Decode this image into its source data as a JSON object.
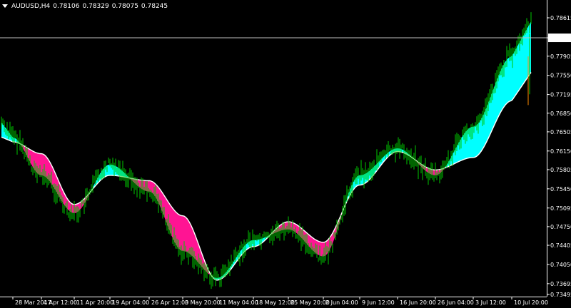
{
  "header": {
    "symbol": "AUDUSD,H4",
    "open": "0.78106",
    "high": "0.78329",
    "low": "0.78075",
    "close": "0.78245"
  },
  "colors": {
    "background": "#000000",
    "candles": "#00c800",
    "band_up": "#00ffff",
    "band_down": "#ff1493",
    "ma_line": "#ffffff",
    "price_line": "#c0c0c0"
  },
  "chart_data": {
    "type": "line",
    "ylim": [
      0.73495,
      0.78615
    ],
    "current_price": "0.78245",
    "price_ticks": [
      "0.78615",
      "0.78245",
      "0.77905",
      "0.77550",
      "0.77195",
      "0.76850",
      "0.76505",
      "0.76150",
      "0.75805",
      "0.75450",
      "0.75095",
      "0.74750",
      "0.74405",
      "0.74050",
      "0.73695",
      "0.73495"
    ],
    "time_ticks": [
      "28 Mar 2017",
      "4 Apr 12:00",
      "11 Apr 20:00",
      "19 Apr 04:00",
      "26 Apr 12:00",
      "3 May 20:00",
      "11 May 04:00",
      "18 May 12:00",
      "25 May 20:00",
      "2 Jun 04:00",
      "9 Jun 12:00",
      "16 Jun 20:00",
      "26 Jun 04:00",
      "3 Jul 12:00",
      "10 Jul 20:00"
    ],
    "series": [
      {
        "x": [
          "28 Mar 2017",
          "4 Apr 12:00",
          "11 Apr 20:00",
          "19 Apr 04:00",
          "26 Apr 12:00",
          "3 May 20:00",
          "11 May 04:00",
          "18 May 12:00",
          "25 May 20:00",
          "2 Jun 04:00",
          "9 Jun 12:00",
          "16 Jun 20:00",
          "26 Jun 04:00",
          "3 Jul 12:00",
          "10 Jul 20:00"
        ],
        "values": [
          0.7632,
          0.761,
          0.7516,
          0.757,
          0.756,
          0.7495,
          0.7376,
          0.7438,
          0.7484,
          0.7446,
          0.7552,
          0.7614,
          0.758,
          0.7603,
          0.7708
        ]
      },
      {
        "x": [
          "28 Mar 2017",
          "4 Apr 12:00",
          "11 Apr 20:00",
          "19 Apr 04:00",
          "26 Apr 12:00",
          "3 May 20:00",
          "11 May 04:00",
          "18 May 12:00",
          "25 May 20:00",
          "2 Jun 04:00",
          "9 Jun 12:00",
          "16 Jun 20:00",
          "26 Jun 04:00",
          "3 Jul 12:00",
          "10 Jul 20:00"
        ],
        "values": [
          0.764,
          0.757,
          0.75,
          0.759,
          0.754,
          0.743,
          0.738,
          0.745,
          0.747,
          0.742,
          0.757,
          0.762,
          0.757,
          0.766,
          0.779
        ]
      }
    ]
  }
}
